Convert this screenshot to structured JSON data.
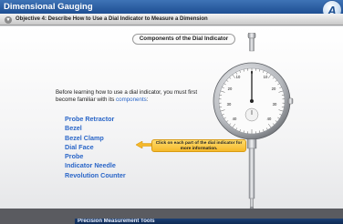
{
  "app": {
    "title": "Dimensional Gauging",
    "logo_letter": "A"
  },
  "objective": {
    "text": "Objective 4: Describe How to Use a Dial Indicator to Measure a Dimension"
  },
  "section_title": "Components of the Dial Indicator",
  "intro": {
    "text": "Before learning how to use a dial indicator, you must first become familiar with its",
    "link": "components",
    "suffix": ":"
  },
  "components": [
    "Probe Retractor",
    "Bezel",
    "Bezel Clamp",
    "Dial Face",
    "Probe",
    "Indicator Needle",
    "Revolution Counter"
  ],
  "callout": {
    "text": "Click on each part of the dial indicator for more information."
  },
  "dial": {
    "left_numbers": [
      "10",
      "20",
      "30",
      "40"
    ],
    "right_numbers": [
      "10",
      "20",
      "30",
      "40"
    ],
    "zero": "0"
  },
  "bottom_window": {
    "title": "Precision Measurement Tools"
  },
  "colors": {
    "titlebar": "#2d5fa6",
    "link": "#2a66c8",
    "callout": "#f5b82a"
  }
}
